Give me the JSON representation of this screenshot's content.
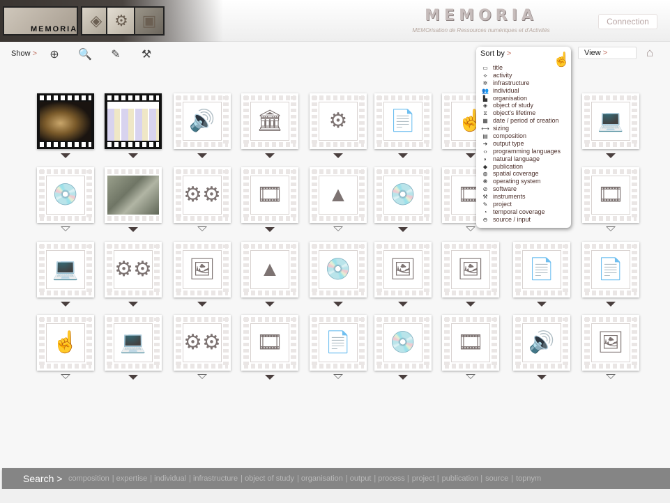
{
  "header": {
    "logo_text": "MEMORIA",
    "title": "MEMORIA",
    "subtitle": "MEMOrisation de Ressources numériques et d'Activités",
    "connection_label": "Connection"
  },
  "toolbar": {
    "show_label": "Show",
    "arrow": ">",
    "tools": [
      "add-icon",
      "search-icon",
      "edit-icon",
      "worker-icon"
    ]
  },
  "view": {
    "label": "View",
    "arrow": ">"
  },
  "sort": {
    "label": "Sort by",
    "arrow": ">",
    "items": [
      {
        "label": "title",
        "icon": "▭"
      },
      {
        "label": "activity",
        "icon": "⟡"
      },
      {
        "label": "infrastructure",
        "icon": "✲"
      },
      {
        "label": "individual",
        "icon": "👥"
      },
      {
        "label": "organisation",
        "icon": "▙"
      },
      {
        "label": "object of study",
        "icon": "◈"
      },
      {
        "label": "object's lifetime",
        "icon": "⧖"
      },
      {
        "label": "date / period of creation",
        "icon": "▦"
      },
      {
        "label": "sizing",
        "icon": "⟷"
      },
      {
        "label": "composition",
        "icon": "▤"
      },
      {
        "label": "output type",
        "icon": "➜"
      },
      {
        "label": "programming languages",
        "icon": "‹›"
      },
      {
        "label": "natural language",
        "icon": "◗"
      },
      {
        "label": "publication",
        "icon": "◆"
      },
      {
        "label": "spatial coverage",
        "icon": "◍"
      },
      {
        "label": "operating system",
        "icon": "❋"
      },
      {
        "label": "software",
        "icon": "⊘"
      },
      {
        "label": "instruments",
        "icon": "⚒"
      },
      {
        "label": "project",
        "icon": "✎"
      },
      {
        "label": "temporal coverage",
        "icon": "◔"
      },
      {
        "label": "source / input",
        "icon": "⊖"
      }
    ]
  },
  "search": {
    "label": "Search >",
    "links": [
      "composition",
      "| expertise",
      "| individual",
      "| infrastructure",
      "| object of study",
      "| organisation",
      "| output",
      "| process |",
      "project |",
      "publication |",
      "source",
      "|",
      "topnym"
    ]
  },
  "tiles": [
    {
      "kind": "map3d",
      "icon": ""
    },
    {
      "kind": "timeline",
      "icon": ""
    },
    {
      "kind": "icon",
      "icon": "🔊"
    },
    {
      "kind": "icon",
      "icon": "🏛"
    },
    {
      "kind": "icon",
      "icon": "⚙"
    },
    {
      "kind": "icon",
      "icon": "📄"
    },
    {
      "kind": "icon",
      "icon": "☝"
    },
    {
      "kind": "hidden",
      "icon": ""
    },
    {
      "kind": "icon",
      "icon": "💻"
    },
    {
      "kind": "icon",
      "icon": "💿"
    },
    {
      "kind": "aerial",
      "icon": ""
    },
    {
      "kind": "icon",
      "icon": "⚙⚙"
    },
    {
      "kind": "icon",
      "icon": "🎞"
    },
    {
      "kind": "icon",
      "icon": "▲"
    },
    {
      "kind": "icon",
      "icon": "💿"
    },
    {
      "kind": "icon",
      "icon": "🎞"
    },
    {
      "kind": "hidden",
      "icon": ""
    },
    {
      "kind": "icon",
      "icon": "🎞"
    },
    {
      "kind": "icon",
      "icon": "💻"
    },
    {
      "kind": "icon",
      "icon": "⚙⚙"
    },
    {
      "kind": "icon",
      "icon": "🖼"
    },
    {
      "kind": "icon",
      "icon": "▲"
    },
    {
      "kind": "icon",
      "icon": "💿"
    },
    {
      "kind": "icon",
      "icon": "🖼"
    },
    {
      "kind": "icon",
      "icon": "🖼"
    },
    {
      "kind": "icon",
      "icon": "📄"
    },
    {
      "kind": "icon",
      "icon": "📄"
    },
    {
      "kind": "icon",
      "icon": "☝"
    },
    {
      "kind": "icon",
      "icon": "💻"
    },
    {
      "kind": "icon",
      "icon": "⚙⚙"
    },
    {
      "kind": "icon",
      "icon": "🎞"
    },
    {
      "kind": "icon",
      "icon": "📄"
    },
    {
      "kind": "icon",
      "icon": "💿"
    },
    {
      "kind": "icon",
      "icon": "🎞"
    },
    {
      "kind": "icon",
      "icon": "🔊"
    },
    {
      "kind": "icon",
      "icon": "🖼"
    }
  ],
  "icons": {
    "add": "⊕",
    "search": "🔍",
    "edit": "✎",
    "worker": "⚒",
    "home": "⌂",
    "hand": "☝"
  }
}
